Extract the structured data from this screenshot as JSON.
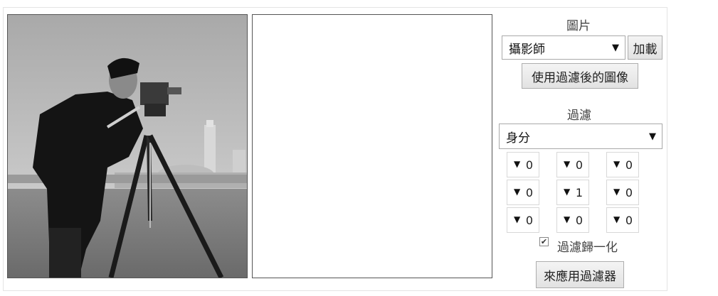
{
  "image_section": {
    "title": "圖片",
    "selected_image": "攝影師",
    "load_button": "加載",
    "use_filtered_button": "使用過濾後的圖像"
  },
  "filter_section": {
    "title": "過濾",
    "selected_filter": "身分",
    "kernel": [
      [
        "0",
        "0",
        "0"
      ],
      [
        "0",
        "1",
        "0"
      ],
      [
        "0",
        "0",
        "0"
      ]
    ],
    "normalize_label": "過濾歸一化",
    "normalize_checked": true,
    "apply_button": "來應用過濾器"
  },
  "icons": {
    "dropdown": "triangle-down-icon",
    "spinner": "triangle-down-icon",
    "checkmark": "check-icon"
  }
}
